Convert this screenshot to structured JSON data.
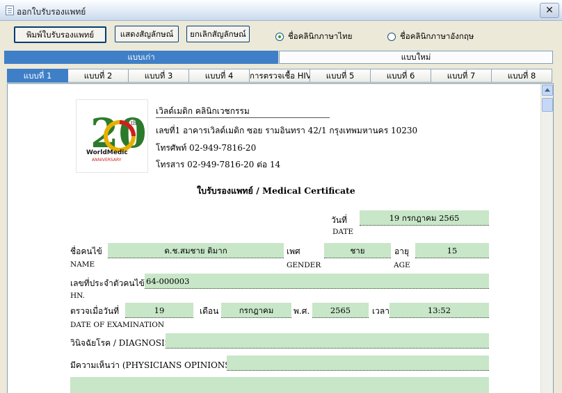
{
  "window": {
    "title": "ออกใบรับรองแพทย์",
    "close_label": "✕"
  },
  "toolbar": {
    "print_label": "พิมพ์ใบรับรองแพทย์",
    "show_sign_label": "แสดงสัญลักษณ์",
    "cancel_sign_label": "ยกเลิกสัญลักษณ์",
    "radio_thai_label": "ชื่อคลินิกภาษาไทย",
    "radio_english_label": "ชื่อคลินิกภาษาอังกฤษ",
    "selected_language": "thai"
  },
  "main_tabs": [
    {
      "label": "แบบเก่า",
      "active": true
    },
    {
      "label": "แบบใหม่",
      "active": false
    }
  ],
  "sub_tabs": [
    {
      "label": "แบบที่ 1",
      "active": true
    },
    {
      "label": "แบบที่ 2"
    },
    {
      "label": "แบบที่ 3"
    },
    {
      "label": "แบบที่ 4"
    },
    {
      "label": "การตรวจเชื้อ HIV"
    },
    {
      "label": "แบบที่ 5"
    },
    {
      "label": "แบบที่ 6"
    },
    {
      "label": "แบบที่ 7"
    },
    {
      "label": "แบบที่ 8"
    }
  ],
  "clinic": {
    "logo_text": "WorldMedic",
    "logo_sub": "ANNIVERSARY",
    "logo_big": "20",
    "logo_th": "th",
    "name": "เวิลด์เมดิก คลินิกเวชกรรม",
    "address": "เลขที่1 อาคารเวิลด์เมดิก ซอย รามอินทรา 42/1 กรุงเทพมหานคร 10230",
    "phone": "โทรศัพท์ 02-949-7816-20",
    "fax": "โทรสาร 02-949-7816-20 ต่อ 14"
  },
  "certificate": {
    "heading": "ใบรับรองแพทย์ / Medical Certificate",
    "date_label": "วันที่",
    "date_en": "DATE",
    "date_value": "19 กรกฎาคม 2565",
    "name_label": "ชื่อคนไข้",
    "name_en": "NAME",
    "name_value": "ด.ช.สมชาย ดิมาก",
    "gender_label": "เพศ",
    "gender_en": "GENDER",
    "gender_value": "ชาย",
    "age_label": "อายุ",
    "age_en": "AGE",
    "age_value": "15",
    "hn_label": "เลขที่ประจำตัวคนไข้",
    "hn_en": "HN.",
    "hn_value": "64-000003",
    "exam_label": "ตรวจเมื่อวันที่",
    "exam_en": "DATE OF EXAMINATION",
    "exam_day": "19",
    "month_label": "เดือน",
    "exam_month": "กรกฎาคม",
    "year_label": "พ.ศ.",
    "exam_year": "2565",
    "time_label": "เวลา",
    "exam_time": "13:52",
    "diagnosis_label": "วินิจฉัยโรค / DIAGNOSIS",
    "diagnosis_value": "",
    "opinion_label": "มีความเห็นว่า (PHYSICIANS OPINIONS)",
    "opinion_value": ""
  },
  "colors": {
    "field_bg": "#c8e6c8",
    "tab_active": "#3f7fc7"
  }
}
